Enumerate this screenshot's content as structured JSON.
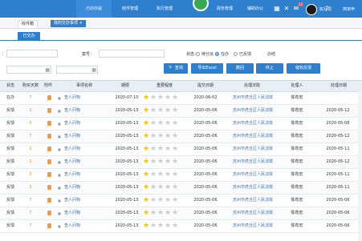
{
  "topbar": {
    "tabs": [
      "刃办办鼠",
      "收件管理",
      "执行管理",
      "政务管理",
      "辅助办公"
    ],
    "badges": [
      "12",
      "99",
      "5",
      "8"
    ],
    "user_label": "执行局",
    "user_extra": "简单申"
  },
  "breadcrumbs": [
    "收件箱",
    "我的交办事项"
  ],
  "subtab": "已交办",
  "filters": {
    "label_a": "：",
    "label_b": "案号：",
    "label_c": "状态：",
    "status_options": [
      "待分派",
      "在办",
      "已反馈",
      "办结"
    ],
    "status_selected": 1
  },
  "buttons": [
    "查询",
    "导出Excel",
    "撤回",
    "终止",
    "催收反馈"
  ],
  "table": {
    "headers": [
      "状态",
      "购买天数",
      "附件",
      "事项名称",
      "期限",
      "重要程度",
      "提交日期",
      "处理法院",
      "处理人",
      "处理日期"
    ],
    "rows": [
      {
        "status": "在办",
        "days": "7",
        "item": "查人问物",
        "deadline": "2020-07-10",
        "stars": 1,
        "submit": "2020-06-02",
        "court": "苏州市虎丘区人民法院",
        "handler": "陈昀宏",
        "date": ""
      },
      {
        "status": "反馈",
        "days": "1",
        "item": "查人问物",
        "deadline": "2020-05-13",
        "stars": 1,
        "submit": "2020-05-06",
        "court": "苏州市虎丘区人民法院",
        "handler": "陈昀宏",
        "date": "2020-05-12"
      },
      {
        "status": "反馈",
        "days": "5",
        "item": "查人问物",
        "deadline": "2020-05-13",
        "stars": 1,
        "submit": "2020-05-06",
        "court": "苏州市虎丘区人民法院",
        "handler": "陈昀宏",
        "date": "2020-05-08"
      },
      {
        "status": "反馈",
        "days": "7",
        "item": "查人问物",
        "deadline": "2020-05-13",
        "stars": 1,
        "submit": "2020-05-06",
        "court": "苏州市虎丘区人民法院",
        "handler": "陈昀宏",
        "date": "2020-05-12"
      },
      {
        "status": "反馈",
        "days": "2",
        "item": "查人问物",
        "deadline": "2020-05-13",
        "stars": 1,
        "submit": "2020-05-06",
        "court": "苏州市虎丘区人民法院",
        "handler": "陈昀宏",
        "date": "2020-05-11"
      },
      {
        "status": "反馈",
        "days": "1",
        "item": "查人问物",
        "deadline": "2020-05-13",
        "stars": 1,
        "submit": "2020-05-06",
        "court": "苏州市虎丘区人民法院",
        "handler": "陈昀宏",
        "date": "2020-05-12"
      },
      {
        "status": "反馈",
        "days": "3",
        "item": "查人问物",
        "deadline": "2020-05-13",
        "stars": 1,
        "submit": "2020-05-06",
        "court": "苏州市虎丘区人民法院",
        "handler": "陈昀宏",
        "date": "2020-05-11"
      },
      {
        "status": "反馈",
        "days": "3",
        "item": "查人问物",
        "deadline": "2020-05-13",
        "stars": 1,
        "submit": "2020-05-06",
        "court": "苏州市虎丘区人民法院",
        "handler": "陈昀宏",
        "date": "2020-05-11"
      },
      {
        "status": "反馈",
        "days": "7",
        "item": "查人问物",
        "deadline": "2020-05-13",
        "stars": 1,
        "submit": "2020-05-06",
        "court": "苏州市虎丘区人民法院",
        "handler": "陈昀宏",
        "date": "2020-05-06"
      },
      {
        "status": "反馈",
        "days": "7",
        "item": "查人问物",
        "deadline": "2020-05-13",
        "stars": 1,
        "submit": "2020-05-06",
        "court": "苏州市虎丘区人民法院",
        "handler": "陈昀宏",
        "date": "2020-05-06"
      },
      {
        "status": "反馈",
        "days": "7",
        "item": "查人问物",
        "deadline": "2020-05-13",
        "stars": 1,
        "submit": "2020-05-06",
        "court": "苏州市虎丘区人民法院",
        "handler": "陈昀宏",
        "date": "2020-05-06"
      }
    ]
  },
  "icons": {
    "logo": "app-logo-icon",
    "calendar": "calendar-icon",
    "doc": "attachment-icon",
    "star": "star-icon"
  },
  "colors": {
    "primary": "#2f7fcf",
    "badge": "#e84a4a",
    "star_on": "#f2c21b",
    "star_off": "#c9cdd3"
  }
}
